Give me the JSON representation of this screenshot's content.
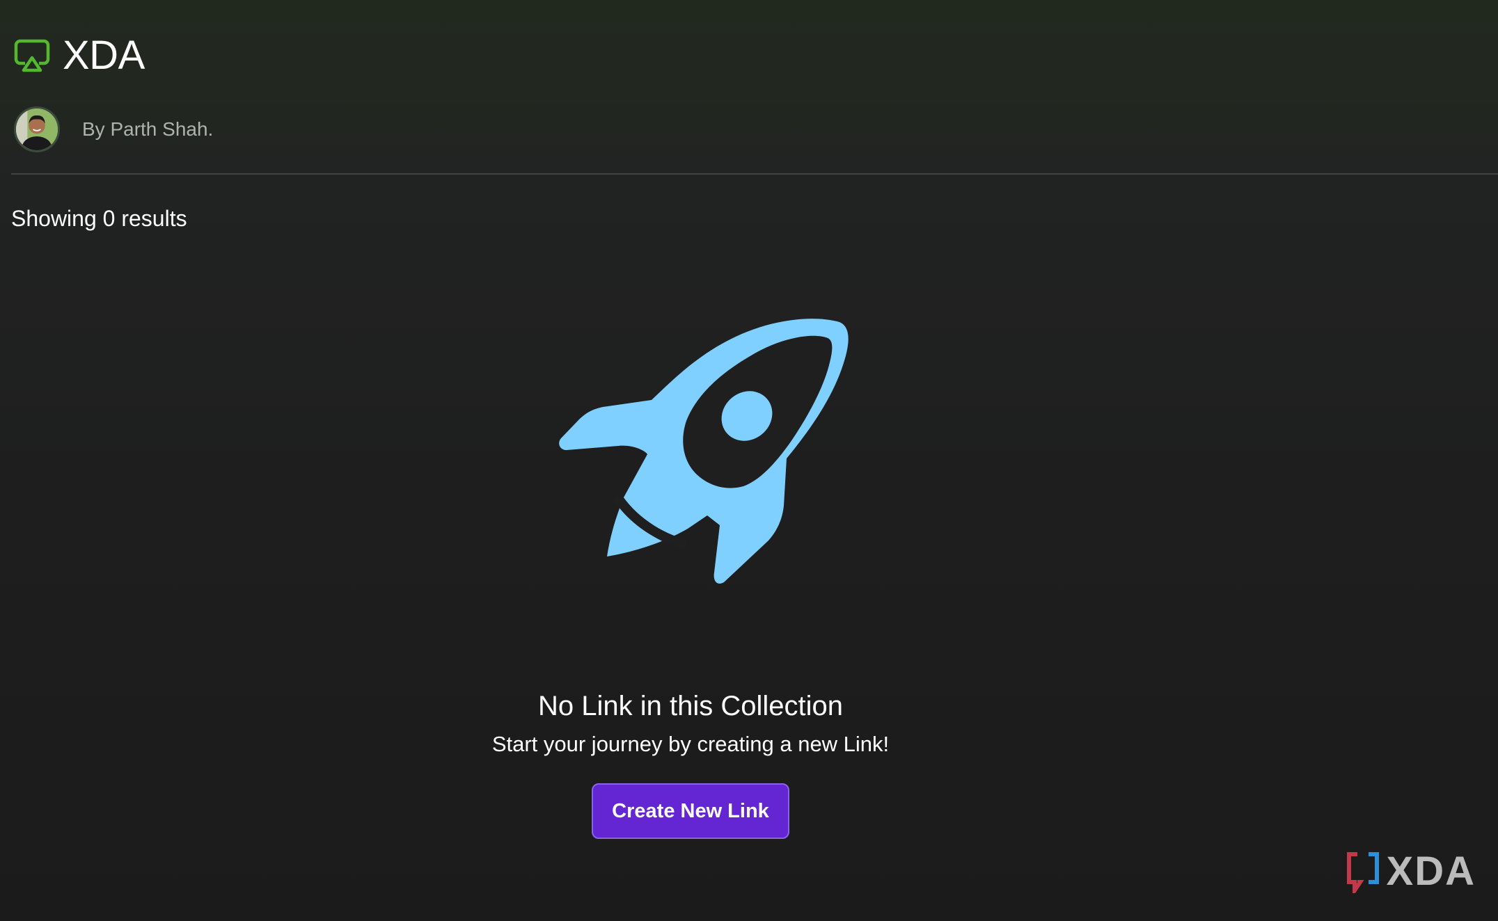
{
  "collection": {
    "title": "XDA",
    "icon": "airplay-screen-icon",
    "icon_color": "#53b82e"
  },
  "author": {
    "byline": "By Parth Shah."
  },
  "results": {
    "summary": "Showing 0 results"
  },
  "empty_state": {
    "icon": "rocket-icon",
    "icon_color": "#7fd0ff",
    "title": "No Link in this Collection",
    "subtitle": "Start your journey by creating a new Link!",
    "button_label": "Create New Link",
    "button_color": "#6326d2"
  },
  "watermark": {
    "text": "XDA"
  }
}
